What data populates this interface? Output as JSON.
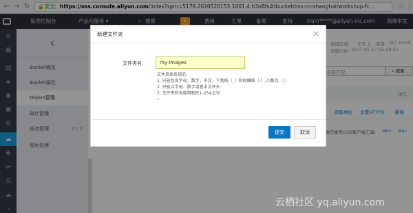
{
  "browser": {
    "secure_label": "安全",
    "url_host": "https://oss.console.aliyun.com",
    "url_path": "/index?spm=5176.2020520153.1001.4.h3nBfs#/bucket/oss-cn-shanghai/workshop-fc..."
  },
  "topbar": {
    "items": [
      "管理控制台",
      "产品与服务 ▾",
      "搜索",
      "费用",
      "工单",
      "备案",
      "支持",
      "train*****@aliyun-inc.com",
      "简体中文"
    ],
    "search_icon": "search-icon",
    "bell_badge": "4"
  },
  "side_panel": {
    "items": [
      {
        "label": "Bucket概览",
        "active": false
      },
      {
        "label": "Bucket属性",
        "active": false
      },
      {
        "label": "Object管理",
        "active": true
      },
      {
        "label": "碎片管理",
        "active": false
      },
      {
        "label": "任务管理",
        "active": false,
        "count": "0 / 0"
      },
      {
        "label": "图片处理",
        "active": false
      }
    ]
  },
  "background": {
    "region_label": "存储区域:",
    "region_value": "华东 2",
    "capacity_label": "容量:",
    "capacity_value": "397.82KB",
    "created_label": "创建时间:",
    "created_value": "2017-05-17 15:49:25",
    "search_placeholder": "前缀匹配",
    "search_button": "搜索",
    "ops_header": "操作",
    "get_address": "获取地址",
    "set_http_header": "设置HTTP头",
    "delete": "删除",
    "client_recommend": "操作推荐OSS客户端工具:",
    "win": "Win",
    "mac": "Mac"
  },
  "dialog": {
    "title": "新建文件夹",
    "field_label": "文件夹名:",
    "input_value": "my-images",
    "rules_title": "文件夹命名规范:",
    "rules": [
      "1. 只能包含字母，数字，中文，下划线（_）和短横线（-）,小数点（.）",
      "2. 只能以字母、数字或者中文开头",
      "3. 文件夹的长度限制在1-254之间",
      "• "
    ],
    "submit_label": "提交",
    "cancel_label": "取消"
  },
  "watermark": "云栖社区 yq.aliyun.com"
}
